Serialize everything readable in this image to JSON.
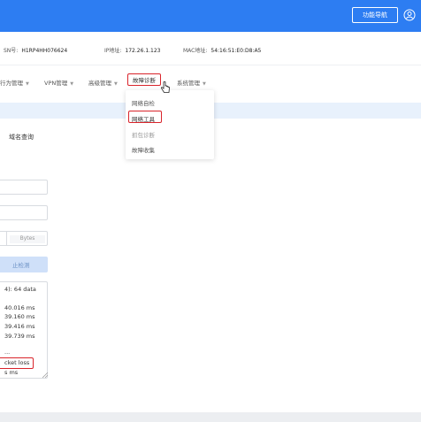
{
  "header": {
    "func_nav_label": "功能导航",
    "brand_color": "#2d7df2"
  },
  "info": {
    "sn_label": "SN号:",
    "sn_value": "H1RP4HH076624",
    "ip_label": "IP地址:",
    "ip_value": "172.26.1.123",
    "mac_label": "MAC地址:",
    "mac_value": "54:16:51:E0:D8:A5"
  },
  "menu": {
    "items": [
      {
        "label": "行为管理"
      },
      {
        "label": "VPN管理"
      },
      {
        "label": "高级管理"
      },
      {
        "label": "故障诊断"
      },
      {
        "label": "系统管理"
      }
    ]
  },
  "dropdown": {
    "items": [
      {
        "label": "网络自检"
      },
      {
        "label": "网络工具"
      },
      {
        "label": "抓包诊断"
      },
      {
        "label": "故障收集"
      }
    ]
  },
  "tabs": {
    "domain_lookup": "域名查询"
  },
  "form": {
    "bytes_unit": "Bytes",
    "stop_label": "止检测"
  },
  "output": {
    "lines": [
      "4): 64 data",
      "",
      "40.016 ms",
      "39.160 ms",
      "39.416 ms",
      "39.739 ms",
      "...",
      "cket loss",
      "s ms"
    ]
  },
  "accent": {
    "highlight_red": "#d9242b"
  }
}
